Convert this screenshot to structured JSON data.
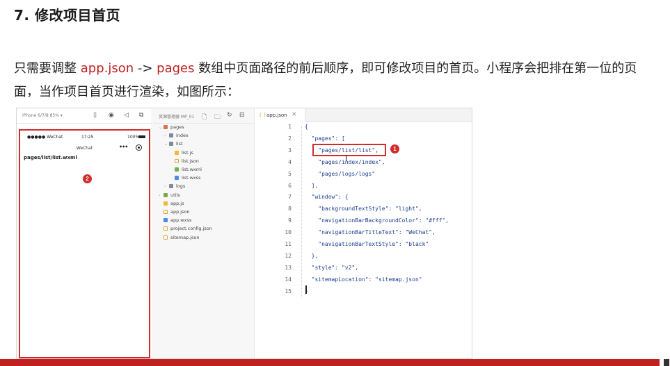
{
  "heading": "7. 修改项目首页",
  "paragraph": {
    "part1": "只需要调整 ",
    "kw_appjson": "app.json",
    "arrow": " -> ",
    "kw_pages": "pages",
    "part2": " 数组中页面路径的前后顺序，即可修改项目的首页。小程序会把排在第一位的页面，当作项目首页进行渲染，如图所示："
  },
  "simulator": {
    "device": "iPhone 6/7/8 85% ▾",
    "toolbar_icons": [
      "phone-icon",
      "record-icon",
      "volume-icon",
      "rotate-icon"
    ],
    "toolbar_glyphs": [
      "▯",
      "◉",
      "◁",
      "⧉"
    ],
    "status_signal": "●●●●● WeChat",
    "status_time": "17:25",
    "status_battery": "100%",
    "nav_title": "WeChat",
    "capsule_dots": "•••",
    "page_text": "pages/list/list.wxml",
    "badge": "2"
  },
  "filetree": {
    "project": "资源管理器 MP_01",
    "toolbar_glyphs": [
      "🗋",
      "🗀",
      "↻",
      "⊟"
    ],
    "nodes": [
      {
        "label": "pages",
        "arrow": "⌄",
        "icon": "folder-red"
      },
      {
        "label": "index",
        "arrow": "›",
        "icon": "folder"
      },
      {
        "label": "list",
        "arrow": "⌄",
        "icon": "folder"
      },
      {
        "label": "list.js",
        "arrow": "",
        "icon": "js"
      },
      {
        "label": "list.json",
        "arrow": "",
        "icon": "json"
      },
      {
        "label": "list.wxml",
        "arrow": "",
        "icon": "wxml"
      },
      {
        "label": "list.wxss",
        "arrow": "",
        "icon": "wxss"
      },
      {
        "label": "logs",
        "arrow": "›",
        "icon": "folder"
      },
      {
        "label": "utils",
        "arrow": "›",
        "icon": "folder-green"
      },
      {
        "label": "app.js",
        "arrow": "",
        "icon": "js"
      },
      {
        "label": "app.json",
        "arrow": "",
        "icon": "json"
      },
      {
        "label": "app.wxss",
        "arrow": "",
        "icon": "wxss"
      },
      {
        "label": "project.config.json",
        "arrow": "",
        "icon": "json"
      },
      {
        "label": "sitemap.json",
        "arrow": "",
        "icon": "json"
      }
    ]
  },
  "editor": {
    "tab_icon": "{ }",
    "tab_name": "app.json",
    "tab_close": "×",
    "line_numbers": [
      "1",
      "2",
      "3",
      "4",
      "5",
      "6",
      "7",
      "8",
      "9",
      "10",
      "11",
      "12",
      "13",
      "14",
      "15"
    ],
    "lines": [
      "{",
      "  \"pages\": [",
      "    \"pages/list/list\",",
      "    \"pages/index/index\",",
      "    \"pages/logs/logs\"",
      "  ],",
      "  \"window\": {",
      "    \"backgroundTextStyle\": \"light\",",
      "    \"navigationBarBackgroundColor\": \"#fff\",",
      "    \"navigationBarTitleText\": \"WeChat\",",
      "    \"navigationBarTextStyle\": \"black\"",
      "  },",
      "  \"style\": \"v2\",",
      "  \"sitemapLocation\": \"sitemap.json\"",
      "}"
    ],
    "badge": "1"
  },
  "colors": {
    "accent_red": "#c0201f",
    "highlight_red": "#d32b2b",
    "code_blue": "#1b3d8f"
  }
}
